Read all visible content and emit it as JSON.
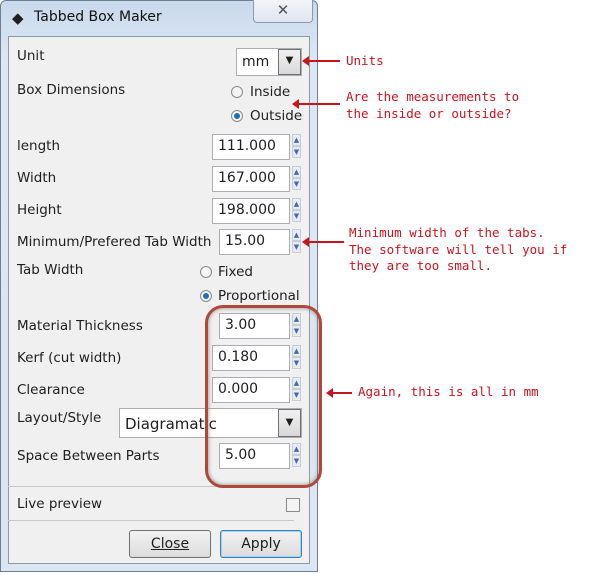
{
  "window": {
    "title": "Tabbed Box Maker",
    "close_icon": "close-icon",
    "app_icon": "inkscape-icon"
  },
  "form": {
    "unit": {
      "label": "Unit",
      "value": "mm"
    },
    "box_dimensions": {
      "label": "Box Dimensions",
      "options": [
        "Inside",
        "Outside"
      ],
      "selected": "Outside"
    },
    "length": {
      "label": "length",
      "value": "111.000"
    },
    "width": {
      "label": "Width",
      "value": "167.000"
    },
    "height": {
      "label": "Height",
      "value": "198.000"
    },
    "tab_min": {
      "label": "Minimum/Prefered Tab Width",
      "value": "15.00"
    },
    "tab_width": {
      "label": "Tab Width",
      "options": [
        "Fixed",
        "Proportional"
      ],
      "selected": "Proportional"
    },
    "thickness": {
      "label": "Material Thickness",
      "value": "3.00"
    },
    "kerf": {
      "label": "Kerf (cut width)",
      "value": "0.180"
    },
    "clearance": {
      "label": "Clearance",
      "value": "0.000"
    },
    "layout": {
      "label": "Layout/Style",
      "value": "Diagramatic"
    },
    "spacing": {
      "label": "Space Between Parts",
      "value": "5.00"
    },
    "live_preview": {
      "label": "Live preview",
      "checked": false
    }
  },
  "buttons": {
    "close": "Close",
    "apply": "Apply"
  },
  "annotations": {
    "units": "Units",
    "inside_outside": [
      "Are the measurements to",
      "the inside or outside?"
    ],
    "tab_width": [
      "Minimum width of the tabs.",
      "The software will tell you if",
      "they are too small."
    ],
    "mm": "Again, this is all in mm"
  },
  "colors": {
    "annotation": "#c8141e",
    "highlight_ring": "#b0473a"
  }
}
